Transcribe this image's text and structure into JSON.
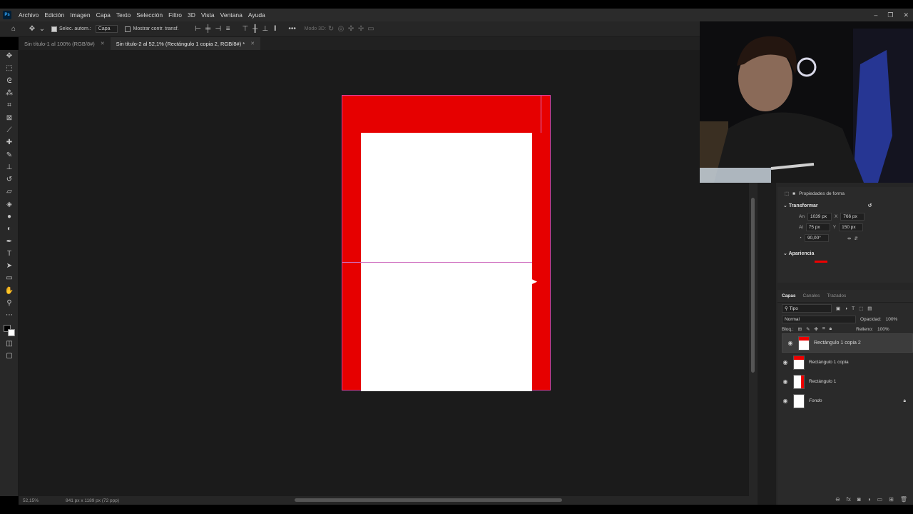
{
  "app": {
    "logo": "Ps"
  },
  "menu": [
    "Archivo",
    "Edición",
    "Imagen",
    "Capa",
    "Texto",
    "Selección",
    "Filtro",
    "3D",
    "Vista",
    "Ventana",
    "Ayuda"
  ],
  "window_controls": {
    "minimize": "–",
    "restore": "❐",
    "close": "✕"
  },
  "options_bar": {
    "auto_select_label": "Selec. autom.:",
    "auto_select_target": "Capa",
    "show_transform_label": "Mostrar contr. transf.",
    "mode_3d_label": "Modo 3D:"
  },
  "tabs": [
    {
      "label": "Sin título-1 al 100% (RGB/8#)",
      "close": "✕"
    },
    {
      "label": "Sin título-2 al 52,1% (Rectángulo 1 copia 2, RGB/8#) *",
      "close": "✕"
    }
  ],
  "status": {
    "zoom": "52,15%",
    "doc_info": "841 px x 1189 px (72 ppp)"
  },
  "properties": {
    "title": "Propiedades de forma",
    "transform_title": "Transformar",
    "width_label": "An",
    "width": "1039 px",
    "x_label": "X",
    "x": "766 px",
    "height_label": "Al",
    "height": "75 px",
    "y_label": "Y",
    "y": "150 px",
    "angle": "90,00°",
    "appearance_title": "Apariencia",
    "fill_color": "#e60000"
  },
  "layers_panel": {
    "tabs": [
      "Capas",
      "Canales",
      "Trazados"
    ],
    "filter": "Tipo",
    "blend_mode": "Normal",
    "opacity_label": "Opacidad:",
    "opacity": "100%",
    "lock_label": "Bloq.:",
    "fill_label": "Relleno:",
    "fill": "100%",
    "layers": [
      {
        "name": "Rectángulo 1 copia 2",
        "selected": true
      },
      {
        "name": "Rectángulo 1 copia",
        "selected": false
      },
      {
        "name": "Rectángulo 1",
        "selected": false
      },
      {
        "name": "Fondo",
        "selected": false
      }
    ]
  },
  "colors": {
    "canvas_red": "#e60000",
    "guide": "#d070c0",
    "panel_bg": "#2a2a2a"
  }
}
